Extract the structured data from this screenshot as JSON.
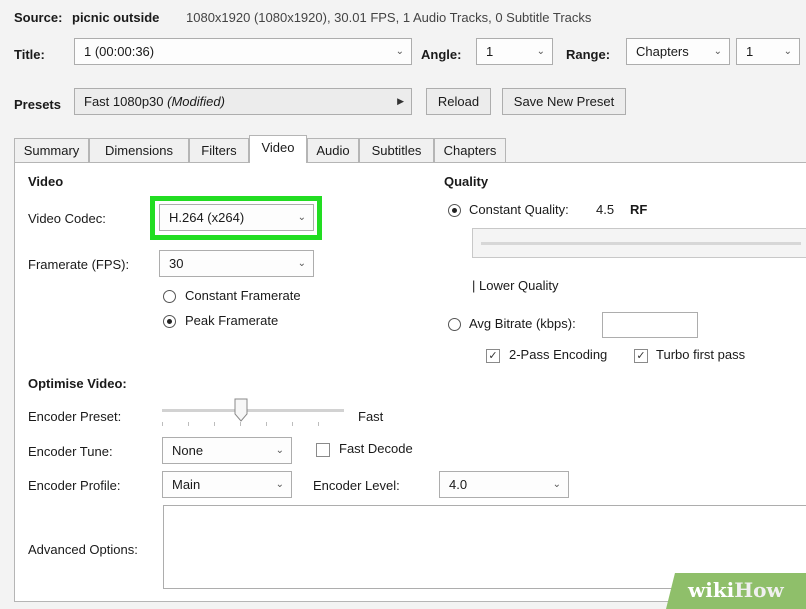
{
  "source": {
    "label": "Source:",
    "name": "picnic outside",
    "details": "1080x1920 (1080x1920), 30.01 FPS, 1 Audio Tracks, 0 Subtitle Tracks"
  },
  "title_row": {
    "title_label": "Title:",
    "title_value": "1 (00:00:36)",
    "angle_label": "Angle:",
    "angle_value": "1",
    "range_label": "Range:",
    "range_value": "Chapters",
    "range_start": "1"
  },
  "presets": {
    "label": "Presets",
    "preset_name": "Fast 1080p30",
    "preset_modified": "(Modified)",
    "reload_label": "Reload",
    "save_new_label": "Save New Preset"
  },
  "tabs": [
    {
      "label": "Summary",
      "active": false
    },
    {
      "label": "Dimensions",
      "active": false
    },
    {
      "label": "Filters",
      "active": false
    },
    {
      "label": "Video",
      "active": true
    },
    {
      "label": "Audio",
      "active": false
    },
    {
      "label": "Subtitles",
      "active": false
    },
    {
      "label": "Chapters",
      "active": false
    }
  ],
  "video": {
    "section_title": "Video",
    "codec_label": "Video Codec:",
    "codec_value": "H.264 (x264)",
    "framerate_label": "Framerate (FPS):",
    "framerate_value": "30",
    "constant_framerate": "Constant Framerate",
    "peak_framerate": "Peak Framerate",
    "selected_framerate_mode": "Peak Framerate",
    "highlight_color": "#22dd22"
  },
  "quality": {
    "section_title": "Quality",
    "constant_quality_label": "Constant Quality:",
    "constant_quality_value": "4.5",
    "constant_quality_unit": "RF",
    "slider_hint": "| Lower Quality",
    "avg_bitrate_label": "Avg Bitrate (kbps):",
    "avg_bitrate_value": "",
    "two_pass_label": "2-Pass Encoding",
    "two_pass_checked": true,
    "turbo_label": "Turbo first pass",
    "turbo_checked": true,
    "selected_mode": "Constant Quality"
  },
  "optimise": {
    "section_title": "Optimise Video:",
    "preset_label": "Encoder Preset:",
    "preset_value": "Fast",
    "tune_label": "Encoder Tune:",
    "tune_value": "None",
    "fast_decode_label": "Fast Decode",
    "fast_decode_checked": false,
    "profile_label": "Encoder Profile:",
    "profile_value": "Main",
    "level_label": "Encoder Level:",
    "level_value": "4.0",
    "advanced_label": "Advanced Options:",
    "advanced_value": ""
  },
  "icons": {
    "dropdown": "chevron-down-icon",
    "submenu": "triangle-right-icon",
    "check": "check-icon"
  },
  "watermark": {
    "wiki": "wiki",
    "how": "How"
  }
}
